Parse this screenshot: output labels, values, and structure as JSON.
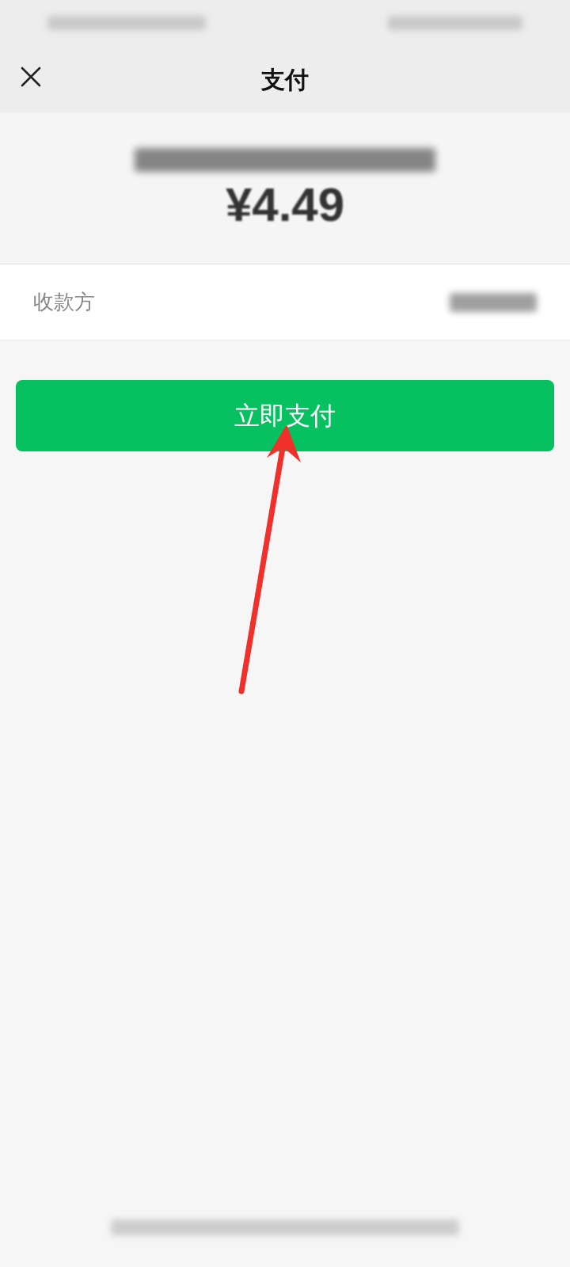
{
  "header": {
    "title": "支付"
  },
  "amount": "¥4.49",
  "payee": {
    "label": "收款方"
  },
  "pay_button": {
    "label": "立即支付"
  }
}
